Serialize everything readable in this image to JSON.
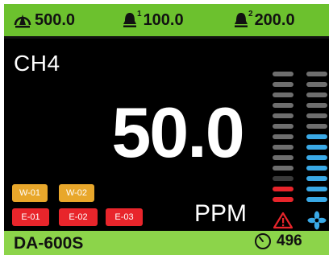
{
  "topbar": {
    "main_value": "500.0",
    "alarm1": {
      "level": "1",
      "value": "100.0"
    },
    "alarm2": {
      "level": "2",
      "value": "200.0"
    },
    "icons": [
      "main-sensor-icon",
      "alarm-bell-icon",
      "alarm-bell-icon"
    ]
  },
  "display": {
    "gas": "CH4",
    "reading": "50.0",
    "unit": "PPM"
  },
  "badges": {
    "warnings": [
      "W-01",
      "W-02"
    ],
    "errors": [
      "E-01",
      "E-02",
      "E-03"
    ]
  },
  "level_bars": {
    "count": 13,
    "left": [
      "red",
      "red",
      "dark",
      "gray",
      "gray",
      "gray",
      "gray",
      "gray",
      "gray",
      "gray",
      "gray",
      "gray",
      "gray"
    ],
    "right": [
      "blue",
      "blue",
      "blue",
      "blue",
      "blue",
      "blue",
      "blue",
      "gray",
      "gray",
      "gray",
      "gray",
      "gray",
      "gray"
    ]
  },
  "status_icons": [
    "alarm-warning-icon",
    "fan-icon"
  ],
  "footer": {
    "model": "DA-600S",
    "counter": "496",
    "counter_icon": "timer-icon"
  },
  "colors": {
    "topbar": "#6cc12e",
    "footer": "#8cd44a",
    "warning": "#e8a72b",
    "error": "#e8252b",
    "level_blue": "#3aa9e6",
    "level_red": "#e8252b",
    "level_gray": "#6e6e6e"
  }
}
